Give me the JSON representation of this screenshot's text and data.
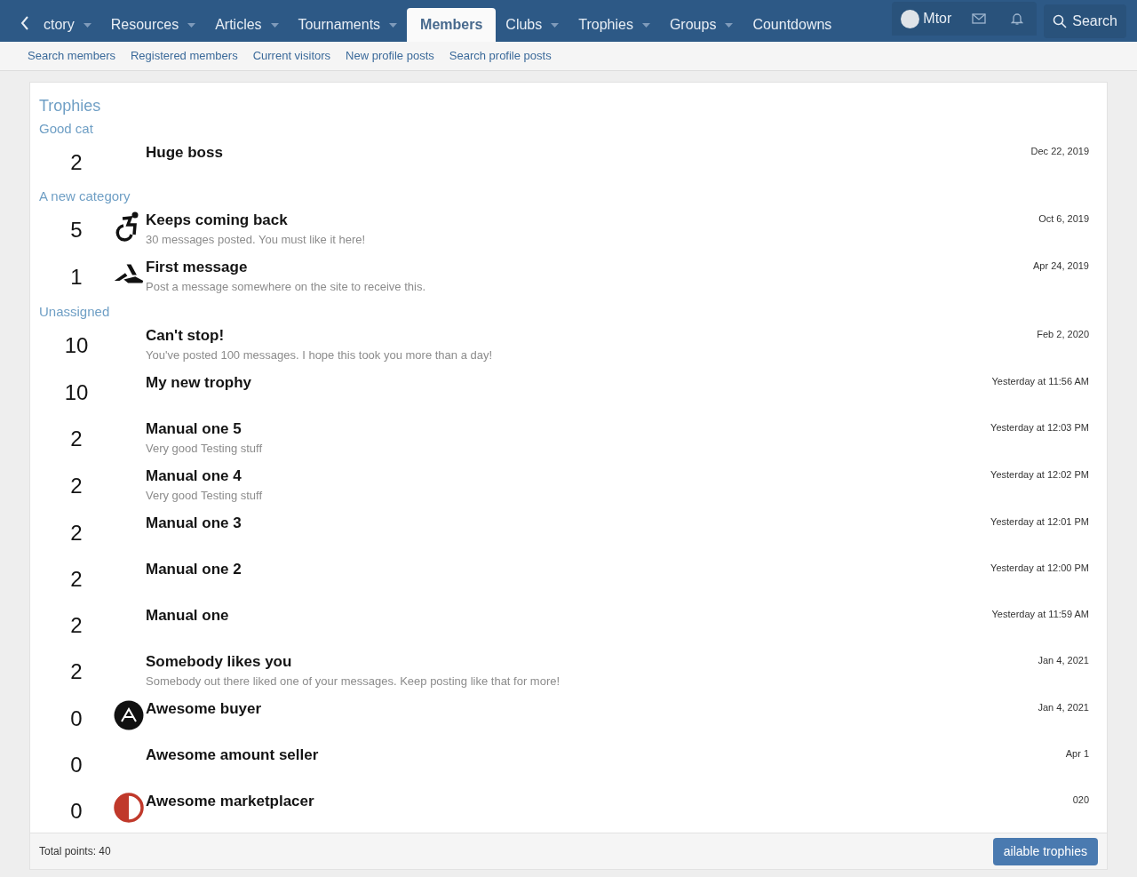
{
  "nav": {
    "tabs": [
      {
        "label": "ctory",
        "selected": false,
        "dropdown": true
      },
      {
        "label": "Resources",
        "selected": false,
        "dropdown": true
      },
      {
        "label": "Articles",
        "selected": false,
        "dropdown": true
      },
      {
        "label": "Tournaments",
        "selected": false,
        "dropdown": true
      },
      {
        "label": "Members",
        "selected": true,
        "dropdown": false
      },
      {
        "label": "Clubs",
        "selected": false,
        "dropdown": true
      },
      {
        "label": "Trophies",
        "selected": false,
        "dropdown": true
      },
      {
        "label": "Groups",
        "selected": false,
        "dropdown": true
      },
      {
        "label": "Countdowns",
        "selected": false,
        "dropdown": false
      }
    ],
    "user": "Mtor",
    "search": "Search"
  },
  "subnav": [
    "Search members",
    "Registered members",
    "Current visitors",
    "New profile posts",
    "Search profile posts"
  ],
  "title": "Trophies",
  "categories": [
    {
      "name": "Good cat",
      "trophies": [
        {
          "points": "2",
          "kind": "plain",
          "title": "Huge boss",
          "date": "Dec 22, 2019"
        }
      ]
    },
    {
      "name": "A new category",
      "trophies": [
        {
          "points": "5",
          "kind": "wheelchair",
          "title": "Keeps coming back",
          "description": "30 messages posted. You must like it here!",
          "date": "Oct 6, 2019"
        },
        {
          "points": "1",
          "kind": "wedge",
          "title": "First message",
          "description": "Post a message somewhere on the site to receive this.",
          "date": "Apr 24, 2019"
        }
      ]
    },
    {
      "name": "Unassigned",
      "trophies": [
        {
          "points": "10",
          "kind": "plain",
          "title": "Can't stop!",
          "description": "You've posted 100 messages. I hope this took you more than a day!",
          "date": "Feb 2, 2020"
        },
        {
          "points": "10",
          "kind": "plain",
          "title": "My new trophy",
          "date": "Yesterday at 11:56 AM"
        },
        {
          "points": "2",
          "kind": "plain",
          "title": "Manual one 5",
          "description": "Very good Testing stuff",
          "date": "Yesterday at 12:03 PM"
        },
        {
          "points": "2",
          "kind": "plain",
          "title": "Manual one 4",
          "description": "Very good Testing stuff",
          "date": "Yesterday at 12:02 PM"
        },
        {
          "points": "2",
          "kind": "plain",
          "title": "Manual one 3",
          "date": "Yesterday at 12:01 PM"
        },
        {
          "points": "2",
          "kind": "plain",
          "title": "Manual one 2",
          "date": "Yesterday at 12:00 PM"
        },
        {
          "points": "2",
          "kind": "plain",
          "title": "Manual one",
          "date": "Yesterday at 11:59 AM"
        },
        {
          "points": "2",
          "kind": "plain",
          "title": "Somebody likes you",
          "description": "Somebody out there liked one of your messages. Keep posting like that for more!",
          "date": "Jan 4, 2021"
        },
        {
          "points": "0",
          "kind": "letter",
          "title": "Awesome buyer",
          "date": "Jan 4, 2021"
        },
        {
          "points": "0",
          "kind": "plain",
          "title": "Awesome amount seller",
          "date": "Apr 1"
        },
        {
          "points": "0",
          "kind": "half",
          "title": "Awesome marketplacer",
          "date": "020"
        }
      ]
    }
  ],
  "footer": {
    "total": "Total points: 40",
    "button": "ailable trophies"
  }
}
